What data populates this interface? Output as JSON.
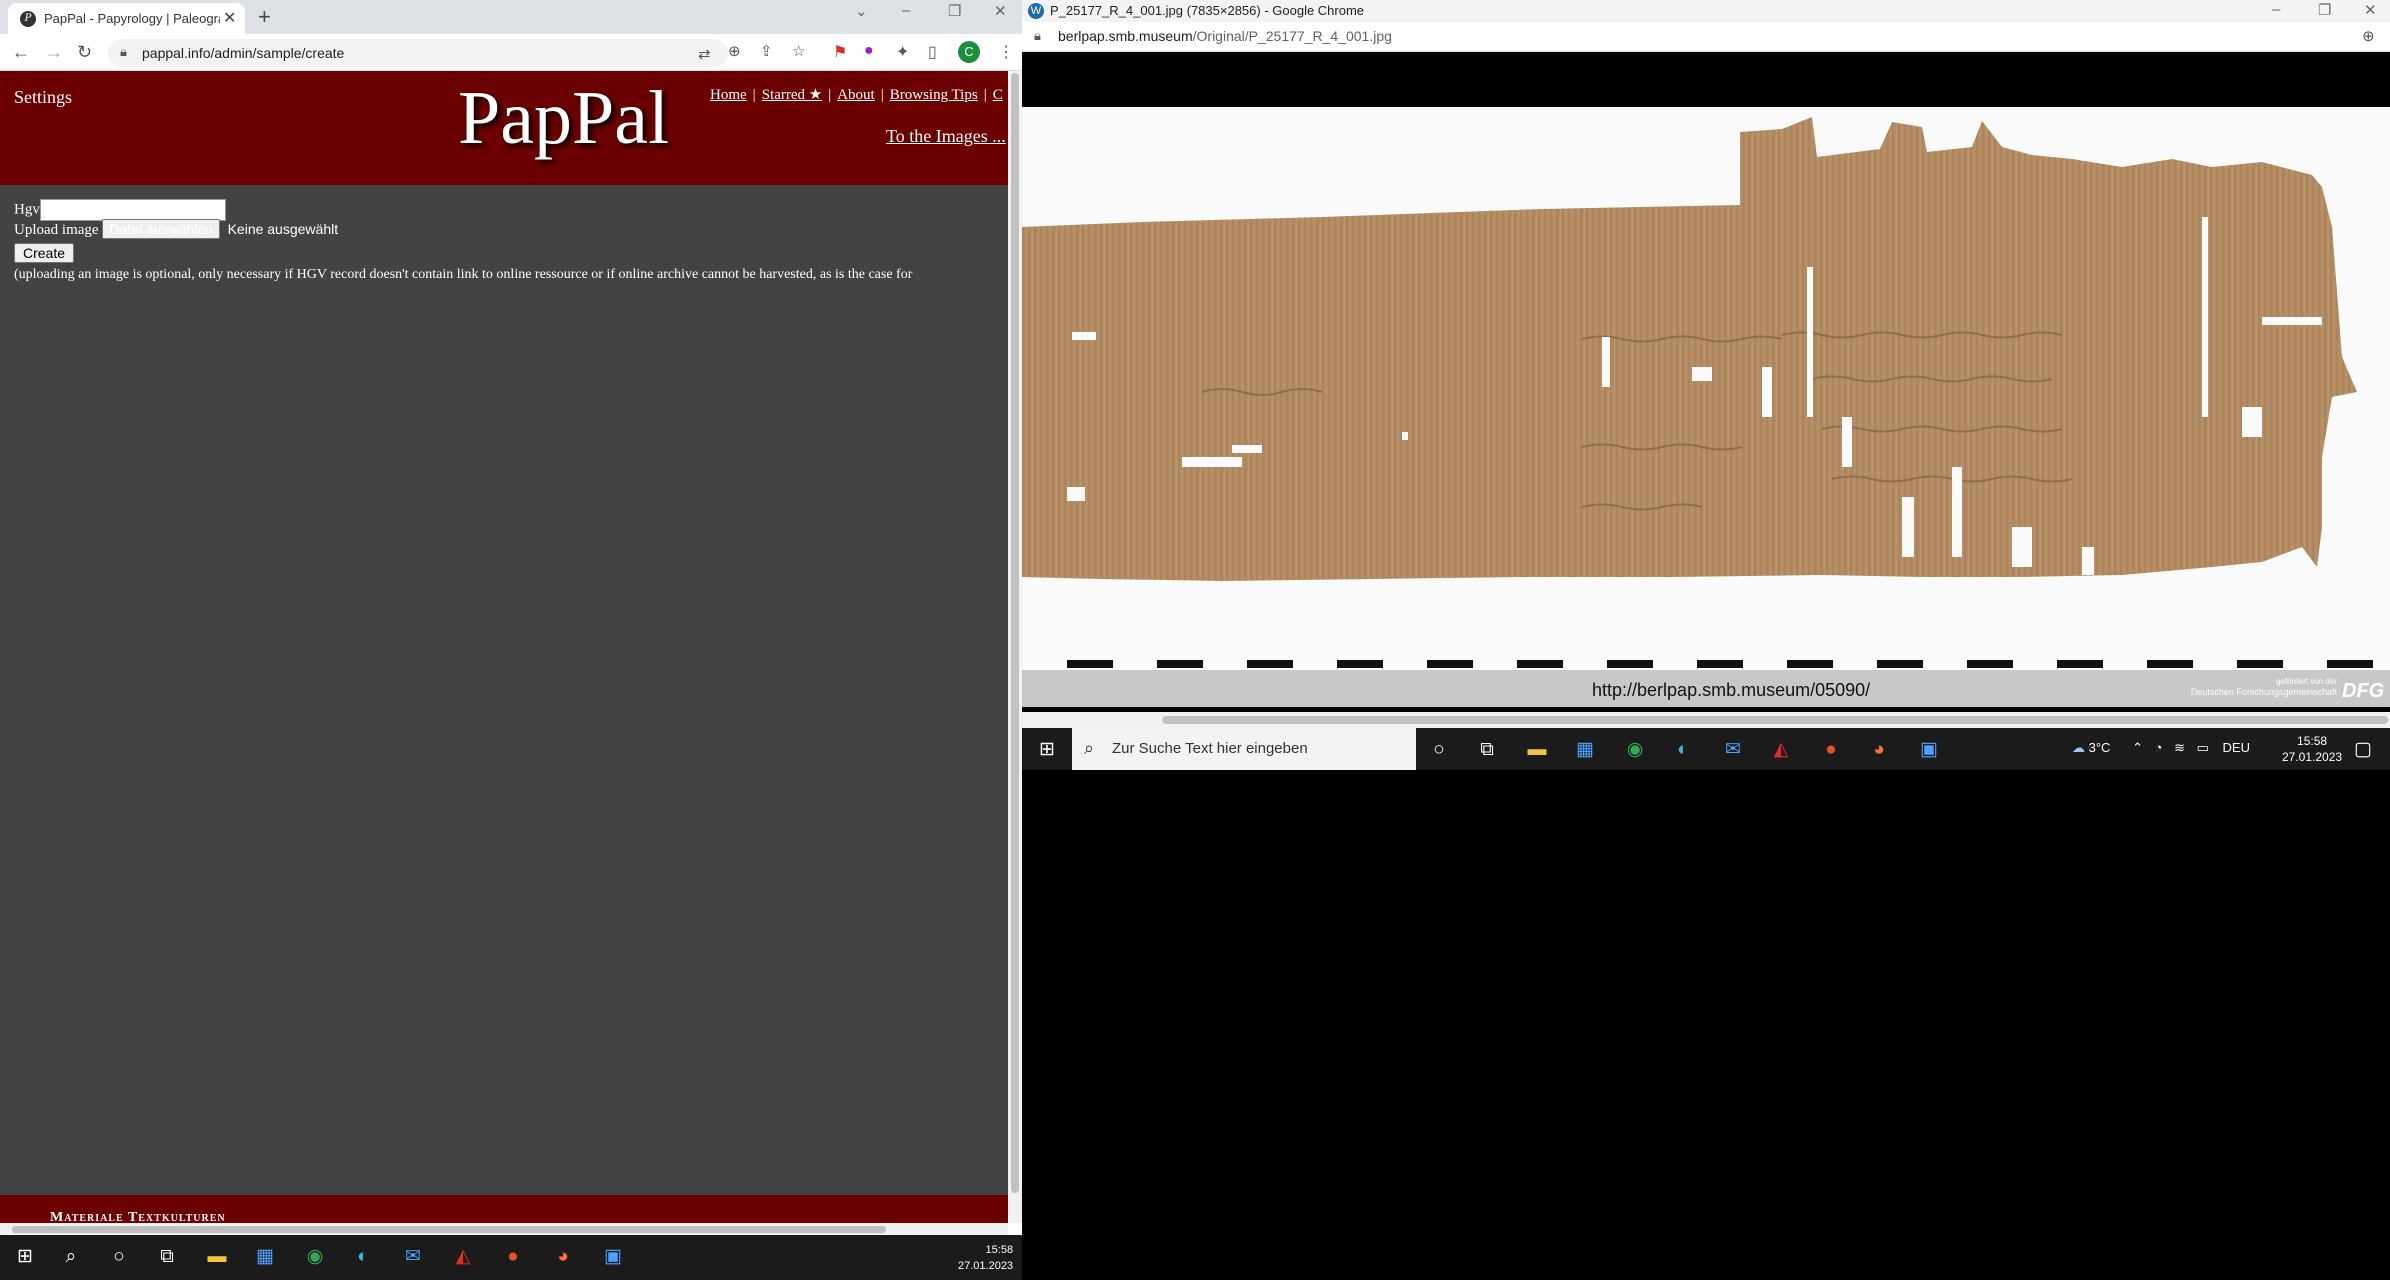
{
  "left_browser": {
    "tab_title": "PapPal - Papyrology | Paleograph",
    "url": "pappal.info/admin/sample/create",
    "profile_initial": "C"
  },
  "pappal": {
    "settings_label": "Settings",
    "logo": "PapPal",
    "nav": [
      "Home",
      "Starred ★",
      "About",
      "Browsing Tips",
      "C"
    ],
    "to_images": "To the Images ...",
    "hgv_label": "Hgv",
    "hgv_value": "",
    "upload_label": "Upload image",
    "file_button": "Datei auswählen",
    "file_none": "Keine ausgewählt",
    "create_button": "Create",
    "note": "(uploading an image is optional, only necessary if HGV record doesn't contain link to online ressource or if online archive cannot be harvested, as is the case for",
    "footer": "Materiale Textkulturen"
  },
  "left_taskbar": {
    "time": "15:58",
    "date": "27.01.2023"
  },
  "right_browser": {
    "title": "P_25177_R_4_001.jpg (7835×2856) - Google Chrome",
    "url_host": "berlpap.smb.museum",
    "url_path": "/Original/P_25177_R_4_001.jpg",
    "image_url_caption": "http://berlpap.smb.museum/05090/",
    "dfg_line1": "gefördert von der",
    "dfg_line2": "Deutschen Forschungsgemeinschaft",
    "dfg_logo": "DFG"
  },
  "right_taskbar": {
    "search_placeholder": "Zur Suche Text hier eingeben",
    "weather": "3°C",
    "language": "DEU",
    "time": "15:58",
    "date": "27.01.2023"
  }
}
